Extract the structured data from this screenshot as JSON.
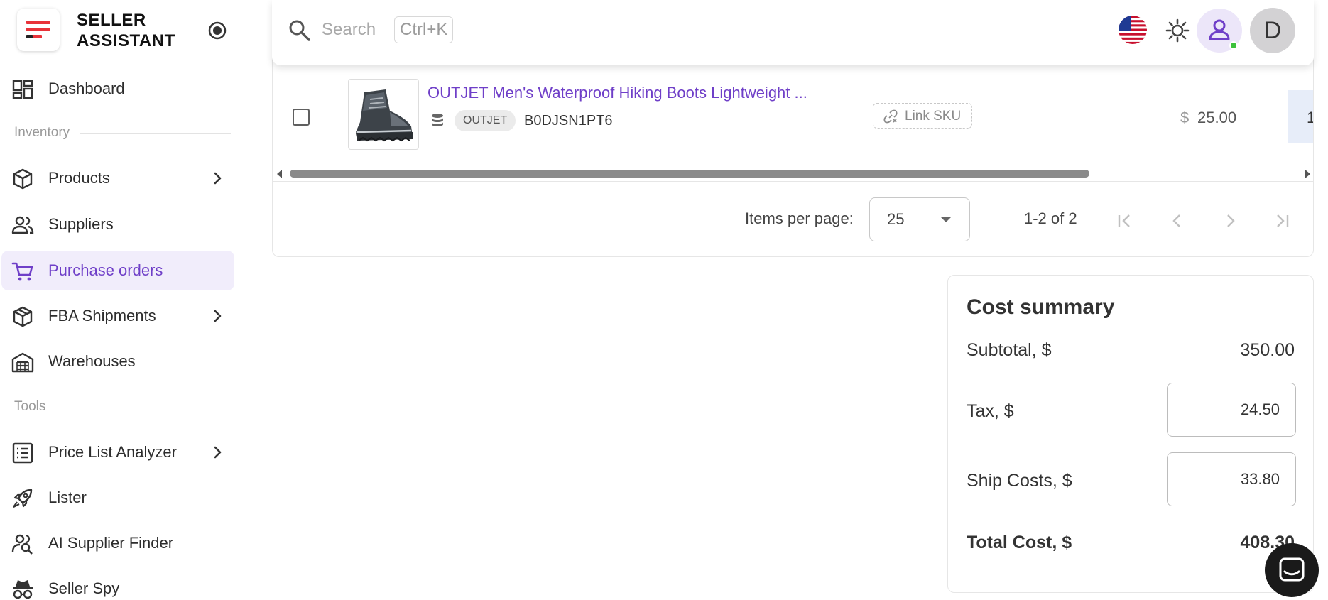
{
  "brand": {
    "name_line1": "SELLER",
    "name_line2": "ASSISTANT"
  },
  "sidebar": {
    "items": [
      {
        "label": "Dashboard"
      },
      {
        "label": "Products"
      },
      {
        "label": "Suppliers"
      },
      {
        "label": "Purchase orders"
      },
      {
        "label": "FBA Shipments"
      },
      {
        "label": "Warehouses"
      },
      {
        "label": "Price List Analyzer"
      },
      {
        "label": "Lister"
      },
      {
        "label": "AI Supplier Finder"
      },
      {
        "label": "Seller Spy"
      }
    ],
    "sections": {
      "inventory": "Inventory",
      "tools": "Tools"
    },
    "active_item": "Purchase orders"
  },
  "topbar": {
    "search_placeholder": "Search",
    "search_shortcut": "Ctrl+K",
    "avatar_initial": "D"
  },
  "table": {
    "row": {
      "title": "OUTJET Men's Waterproof Hiking Boots Lightweight ...",
      "brand": "OUTJET",
      "asin": "B0DJSN1PT6",
      "link_sku_label": "Link SKU",
      "currency_symbol": "$",
      "price": "25.00",
      "qty_partial": "1"
    },
    "pagination": {
      "items_per_page_label": "Items per page:",
      "items_per_page_value": "25",
      "range": "1-2 of 2"
    }
  },
  "cost_summary": {
    "title": "Cost summary",
    "subtotal_label": "Subtotal, $",
    "subtotal_value": "350.00",
    "tax_label": "Tax, $",
    "tax_value": "24.50",
    "ship_label": "Ship Costs, $",
    "ship_value": "33.80",
    "total_label": "Total Cost, $",
    "total_value": "408.30"
  },
  "colors": {
    "accent": "#6f3fc8",
    "active_bg": "#f1edfb",
    "logo_red": "#e8333a",
    "online_dot": "#3cc13b"
  }
}
